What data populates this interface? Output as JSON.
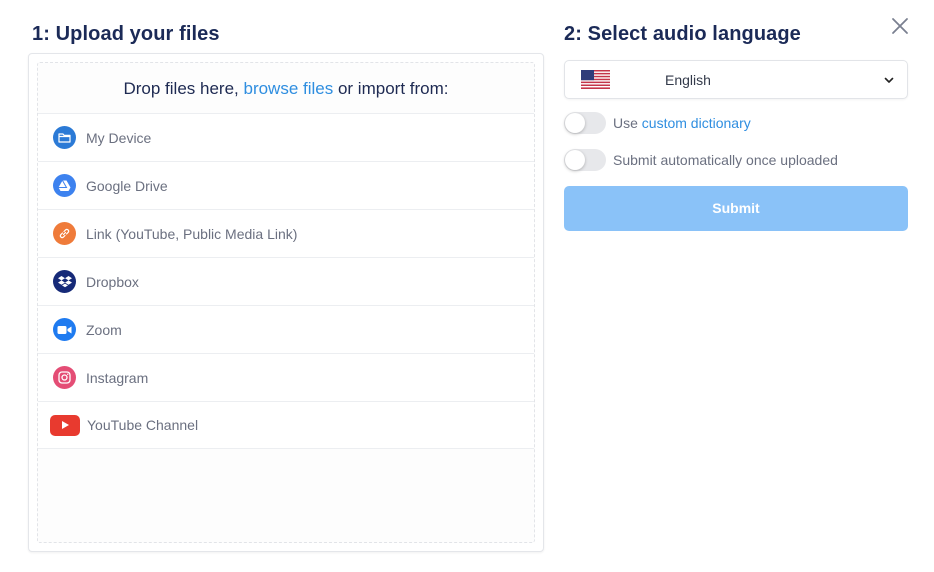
{
  "upload": {
    "title": "1: Upload your files",
    "drop_prefix": "Drop files here, ",
    "browse_link": "browse files",
    "drop_suffix": " or import from:",
    "sources": [
      {
        "label": "My Device",
        "icon": "folder-icon",
        "color": "#2b7ad6"
      },
      {
        "label": "Google Drive",
        "icon": "google-drive-icon",
        "color": "#3d82ef"
      },
      {
        "label": "Link (YouTube, Public Media Link)",
        "icon": "link-icon",
        "color": "#ef7b3a"
      },
      {
        "label": "Dropbox",
        "icon": "dropbox-icon",
        "color": "#162a78"
      },
      {
        "label": "Zoom",
        "icon": "zoom-icon",
        "color": "#1f7bf0"
      },
      {
        "label": "Instagram",
        "icon": "instagram-icon",
        "color": "#e44d75"
      },
      {
        "label": "YouTube Channel",
        "icon": "youtube-icon",
        "color": "#e83a2f"
      }
    ]
  },
  "language": {
    "title": "2: Select audio language",
    "selected": "English",
    "flag": "us-flag-icon"
  },
  "options": {
    "dictionary_prefix": "Use ",
    "dictionary_link": "custom dictionary",
    "dictionary_on": false,
    "auto_submit_label": "Submit automatically once uploaded",
    "auto_submit_on": false
  },
  "submit_label": "Submit",
  "colors": {
    "accent": "#2f8ee0",
    "submit_disabled": "#8ac2f8",
    "heading": "#1b2a57"
  }
}
